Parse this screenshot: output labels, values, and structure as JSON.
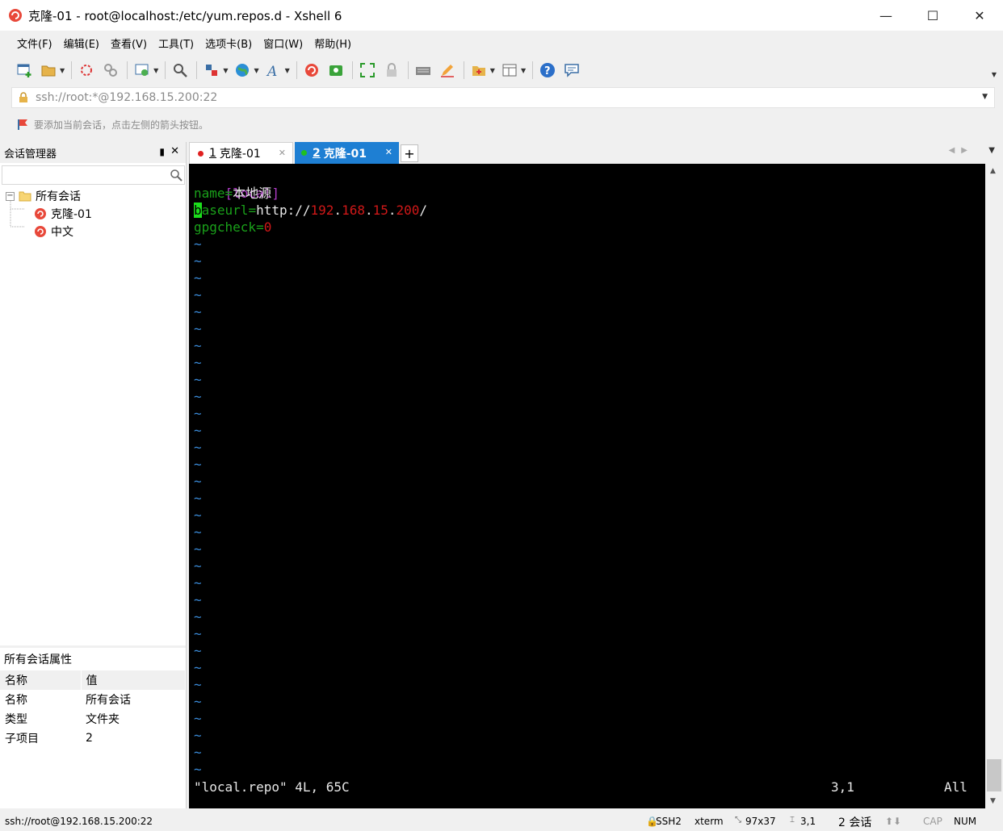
{
  "window": {
    "title": "克隆-01 - root@localhost:/etc/yum.repos.d - Xshell 6",
    "minimize": "—",
    "maximize": "☐",
    "close": "✕"
  },
  "menu": [
    "文件(F)",
    "编辑(E)",
    "查看(V)",
    "工具(T)",
    "选项卡(B)",
    "窗口(W)",
    "帮助(H)"
  ],
  "address": {
    "value": "ssh://root:*@192.168.15.200:22"
  },
  "hint": "要添加当前会话，点击左侧的箭头按钮。",
  "session_manager": {
    "title": "会话管理器",
    "pin": "▮",
    "close": "✕",
    "tree": {
      "root": "所有会话",
      "toggle": "−",
      "children": [
        "克隆-01",
        "中文"
      ]
    }
  },
  "properties": {
    "title": "所有会话属性",
    "headers": [
      "名称",
      "值"
    ],
    "rows": [
      [
        "名称",
        "所有会话"
      ],
      [
        "类型",
        "文件夹"
      ],
      [
        "子项目",
        "2"
      ]
    ]
  },
  "tabs": [
    {
      "num": "1",
      "label": "克隆-01",
      "dot_color": "#e02020",
      "close": "✕"
    },
    {
      "num": "2",
      "label": "克隆-01",
      "dot_color": "#20c020",
      "close": "✕"
    }
  ],
  "tab_add": "+",
  "terminal": {
    "line1": "[local]",
    "line2_key": "name=",
    "line2_val": "本地源",
    "line3_cursor": "b",
    "line3_key": "aseurl=",
    "line3_proto": "http://",
    "line3_ip1": "192",
    "line3_ip2": "168",
    "line3_ip3": "15",
    "line3_ip4": "200",
    "line3_dot": ".",
    "line3_slash": "/",
    "line4_key": "gpgcheck=",
    "line4_val": "0",
    "tilde": "~",
    "status_file": "\"local.repo\" 4L, 65C",
    "status_pos": "3,1",
    "status_all": "All"
  },
  "statusbar": {
    "connection": "ssh://root@192.168.15.200:22",
    "protocol": "SSH2",
    "term": "xterm",
    "size": "97x37",
    "cursor": "3,1",
    "sessions": "2 会话",
    "cap": "CAP",
    "num": "NUM"
  },
  "colors": {
    "tab_active": "#1e7fd3",
    "terminal_bg": "#000000",
    "section": "#b03cc7",
    "key": "#1aa11a",
    "number": "#d11818",
    "tilde": "#3b8bd9",
    "cursor": "#1cde1c"
  },
  "icons": [
    "new-session-icon",
    "open-folder-icon",
    "reconnect-icon",
    "disconnect-icon",
    "properties-icon",
    "find-icon",
    "transfer-icon",
    "globe-icon",
    "font-icon",
    "xshell-icon",
    "xftp-icon",
    "fullscreen-icon",
    "lock-icon",
    "keyboard-icon",
    "compose-icon",
    "add-folder-icon",
    "layout-icon",
    "help-icon",
    "chat-icon"
  ]
}
